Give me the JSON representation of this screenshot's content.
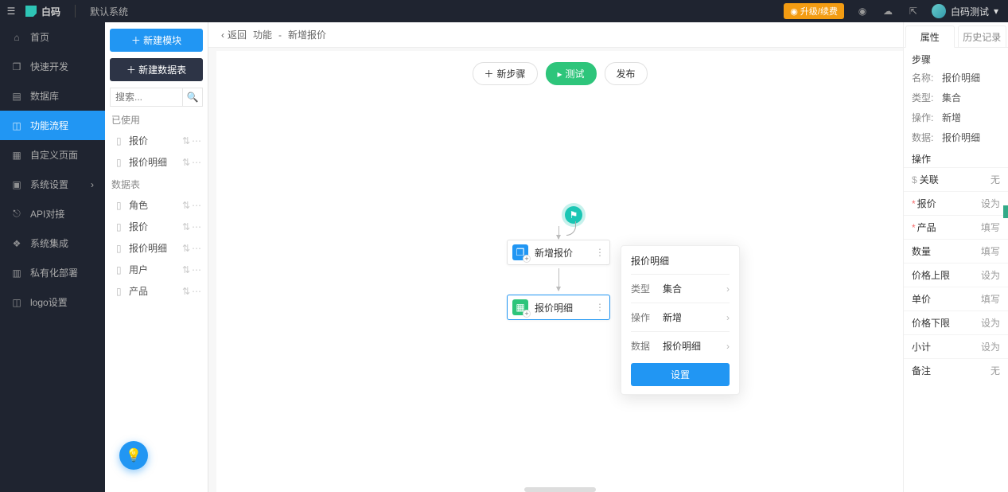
{
  "brand": "白码",
  "system": "默认系统",
  "upgrade": "升级/续费",
  "user_name": "白码测试",
  "nav": {
    "home": "首页",
    "quickdev": "快速开发",
    "database": "数据库",
    "flow": "功能流程",
    "custom_page": "自定义页面",
    "settings": "系统设置",
    "api": "API对接",
    "integration": "系统集成",
    "deploy": "私有化部署",
    "logo": "logo设置"
  },
  "secondary": {
    "new_module": "新建模块",
    "new_table": "新建数据表",
    "search_placeholder": "搜索...",
    "group_used": "已使用",
    "group_tables": "数据表",
    "used": [
      "报价",
      "报价明细"
    ],
    "tables": [
      "角色",
      "报价",
      "报价明细",
      "用户",
      "产品"
    ]
  },
  "crumb": {
    "back": "返回",
    "func": "功能",
    "sep": "-",
    "name": "新增报价"
  },
  "toolbar": {
    "new_step": "新步骤",
    "test": "测试",
    "publish": "发布"
  },
  "nodes": {
    "a": "新增报价",
    "b": "报价明细"
  },
  "popover": {
    "title": "报价明细",
    "type_label": "类型",
    "type_value": "集合",
    "op_label": "操作",
    "op_value": "新增",
    "data_label": "数据",
    "data_value": "报价明细",
    "set": "设置"
  },
  "right": {
    "tab_attr": "属性",
    "tab_history": "历史记录",
    "step_title": "步骤",
    "name_k": "名称:",
    "name_v": "报价明细",
    "type_k": "类型:",
    "type_v": "集合",
    "op_k": "操作:",
    "op_v": "新增",
    "data_k": "数据:",
    "data_v": "报价明细",
    "ops_title": "操作",
    "ops": [
      {
        "l": "关联",
        "r": "无",
        "mark": "dollar"
      },
      {
        "l": "报价",
        "r": "设为",
        "mark": "star"
      },
      {
        "l": "产品",
        "r": "填写",
        "mark": "star"
      },
      {
        "l": "数量",
        "r": "填写",
        "mark": ""
      },
      {
        "l": "价格上限",
        "r": "设为",
        "mark": ""
      },
      {
        "l": "单价",
        "r": "填写",
        "mark": ""
      },
      {
        "l": "价格下限",
        "r": "设为",
        "mark": ""
      },
      {
        "l": "小计",
        "r": "设为",
        "mark": ""
      },
      {
        "l": "备注",
        "r": "无",
        "mark": ""
      }
    ]
  }
}
